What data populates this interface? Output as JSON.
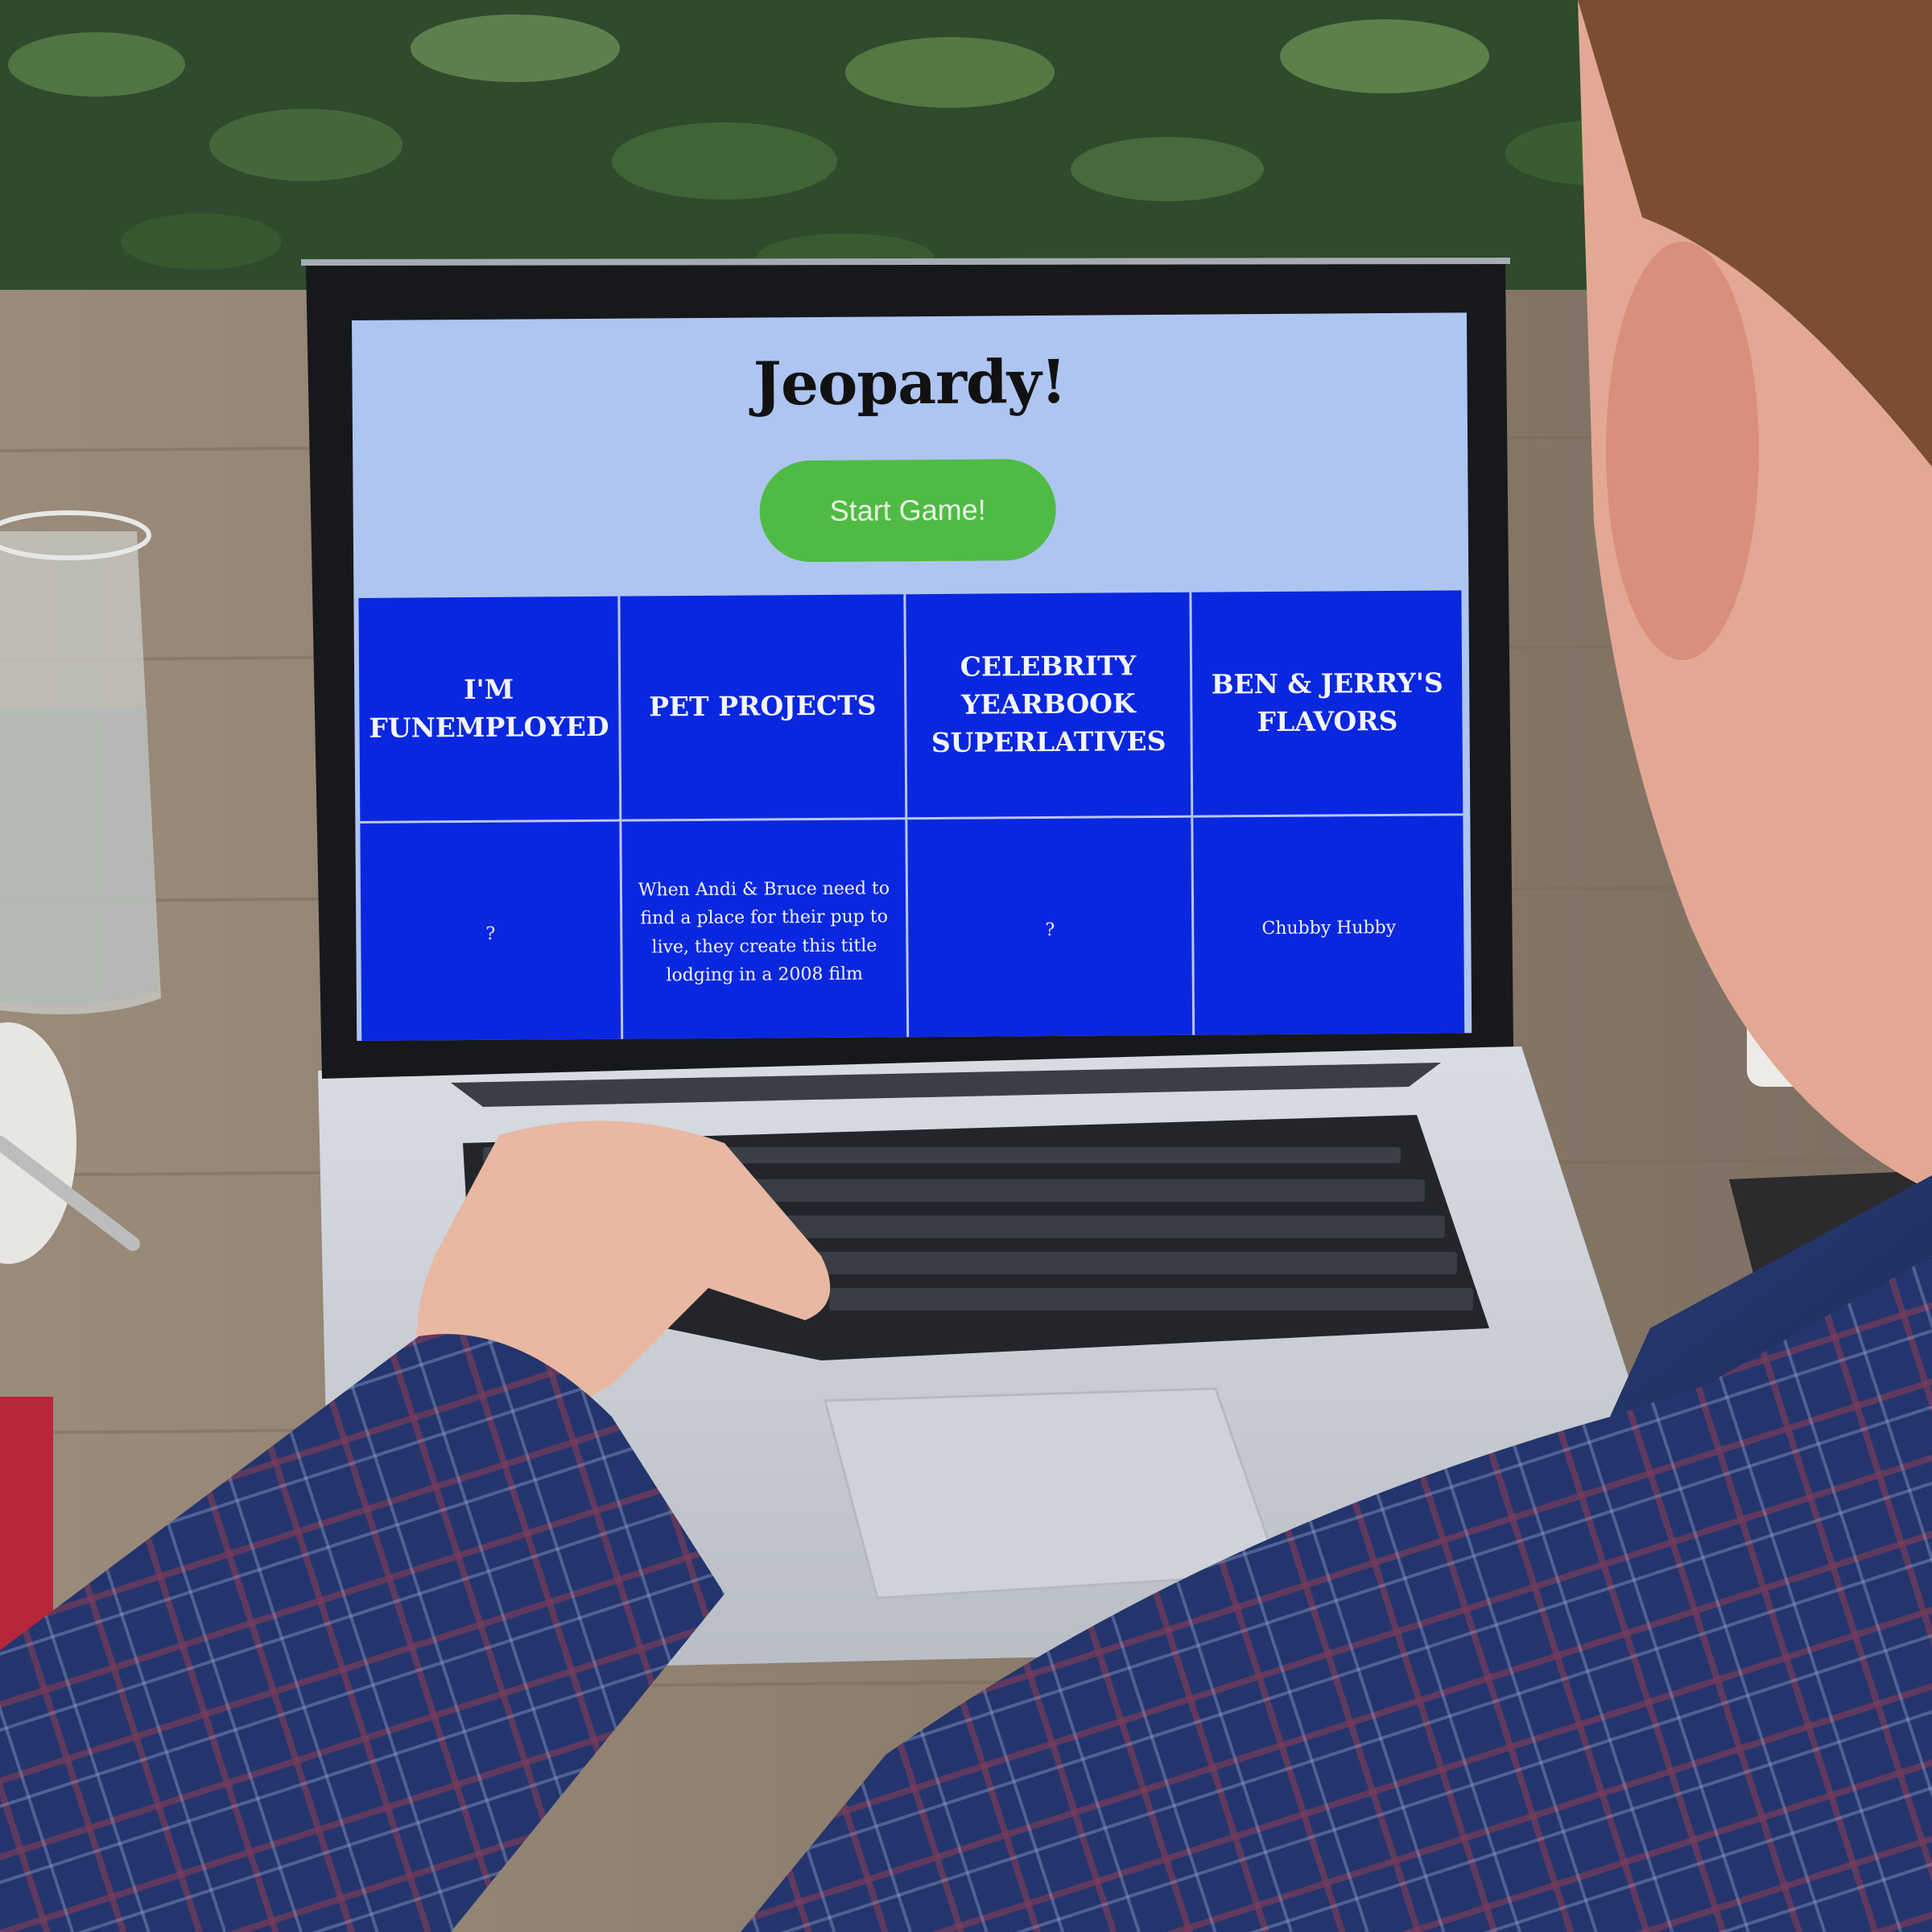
{
  "page": {
    "title": "Jeopardy!",
    "start_button": "Start Game!"
  },
  "board": {
    "categories": [
      "I'M FUNEMPLOYED",
      "PET PROJECTS",
      "CELEBRITY YEARBOOK SUPERLATIVES",
      "BEN & JERRY'S FLAVORS"
    ],
    "clues": [
      "?",
      "When Andi & Bruce need to find a place for their pup to live, they create this title lodging in a 2008 film",
      "?",
      "Chubby Hubby"
    ]
  },
  "colors": {
    "header_bg": "#aec5f2",
    "board_bg": "#0a27e0",
    "button_bg": "#4fbb44",
    "grid_line": "#b9c8f4"
  }
}
